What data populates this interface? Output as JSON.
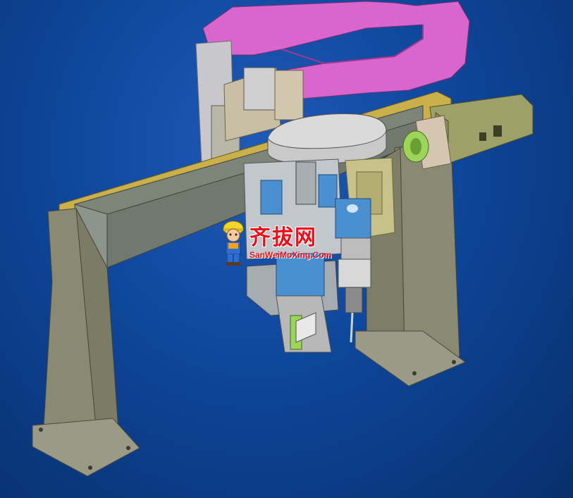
{
  "viewport": {
    "background_color": "#0e469a",
    "content": "3D CAD assembly render of a gantry pick-and-place mechanism"
  },
  "colors": {
    "frame_gray": "#8a8a72",
    "beam_gray": "#7d8579",
    "rail_yellow": "#c9b04a",
    "arm_magenta": "#d966cc",
    "motor_olive": "#9da068",
    "block_blue": "#4a8fd0",
    "coupler_green": "#9dd45a"
  },
  "watermark": {
    "title": "齐拔网",
    "url": "SanWeiMoXing.Com",
    "mascot_icon": "builder-mascot-icon"
  }
}
